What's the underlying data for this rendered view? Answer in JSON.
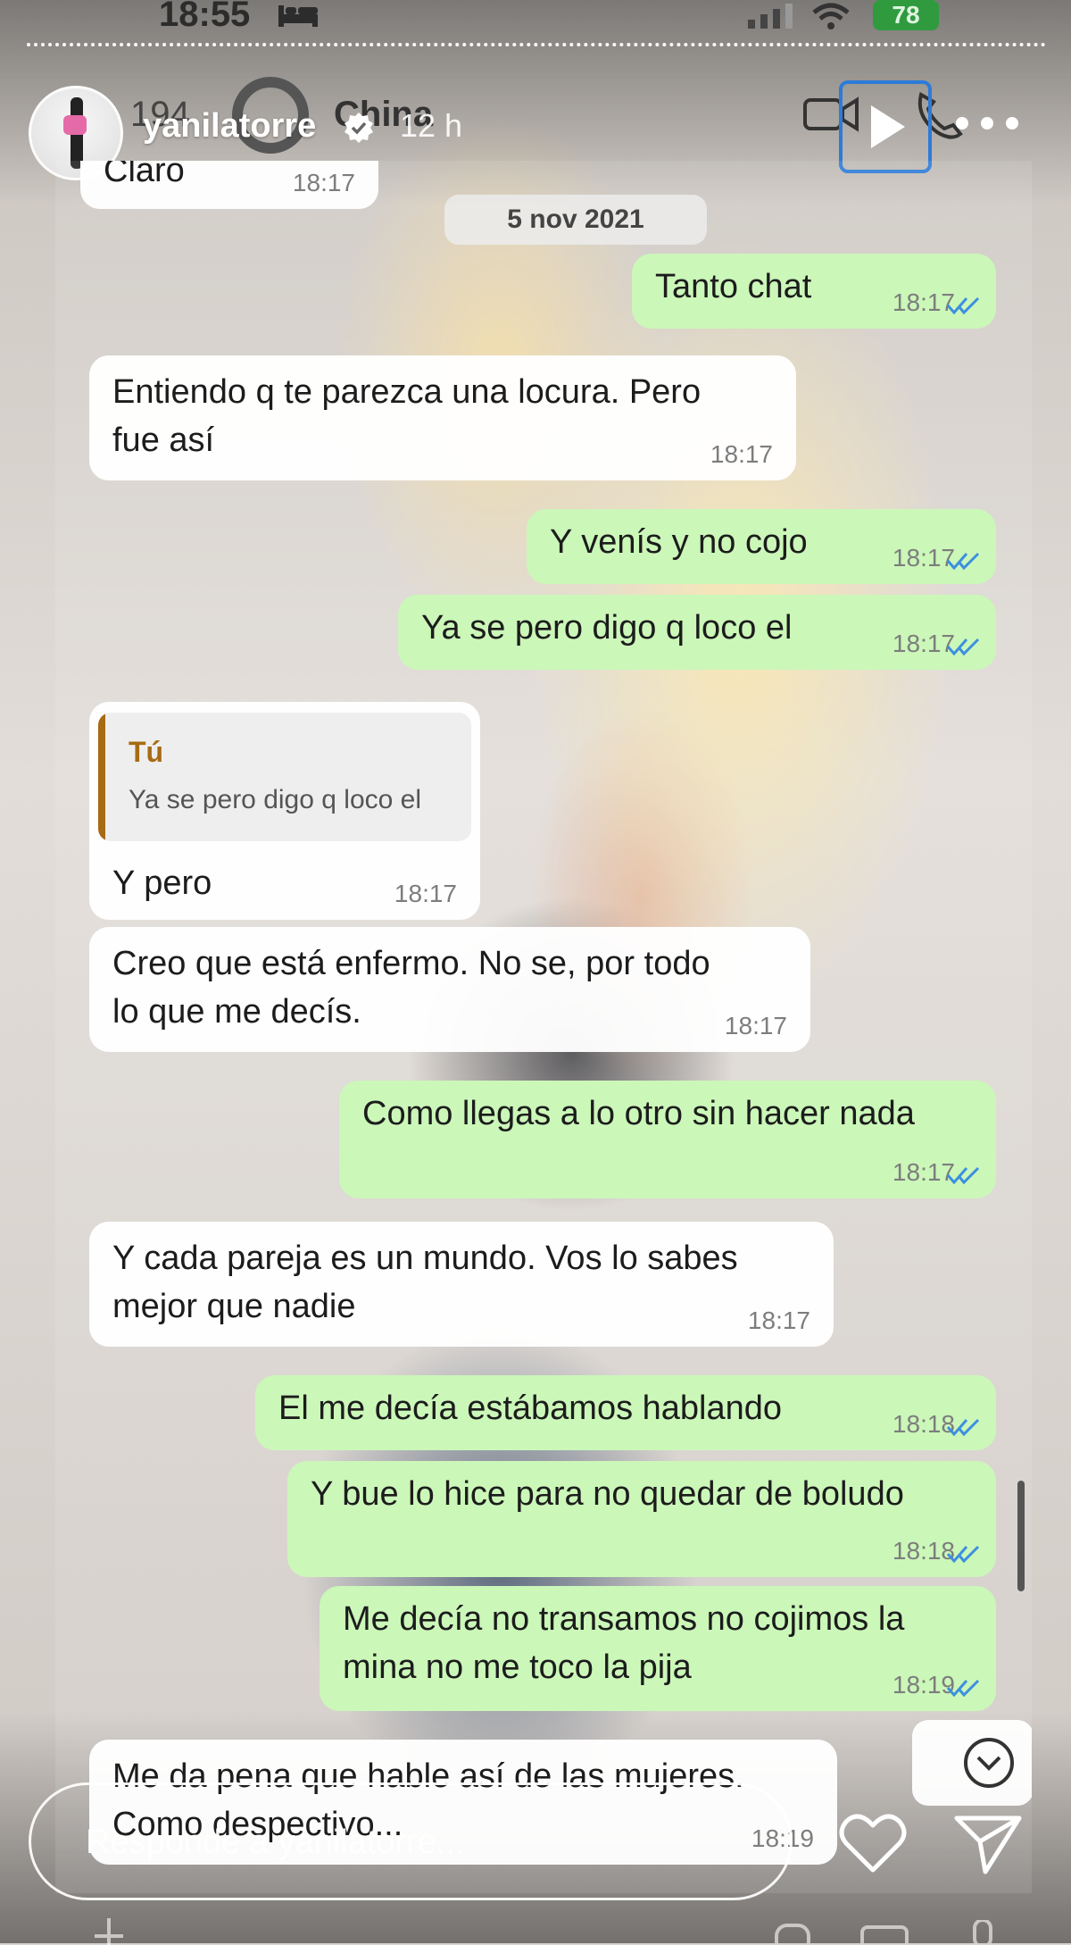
{
  "status_bar": {
    "time": "18:55",
    "battery": "78"
  },
  "story": {
    "username": "yanilatorre",
    "time_ago": "12 h",
    "reply_placeholder": "Responde a yanilatorre..."
  },
  "underlay": {
    "number": "194",
    "name": "China"
  },
  "chat": {
    "date": "5 nov 2021",
    "messages": [
      {
        "type": "in",
        "text": "Claro",
        "time": "18:17"
      },
      {
        "type": "out",
        "text": "Tanto chat",
        "time": "18:17"
      },
      {
        "type": "in",
        "text": "Entiendo q te parezca una locura. Pero\nfue así",
        "time": "18:17"
      },
      {
        "type": "out",
        "text": "Y venís y no cojo",
        "time": "18:17"
      },
      {
        "type": "out",
        "text": "Ya se pero digo q loco el",
        "time": "18:17"
      },
      {
        "type": "in",
        "quote_author": "Tú",
        "quote_text": "Ya se pero digo q loco el",
        "text": "Y pero",
        "time": "18:17"
      },
      {
        "type": "in",
        "text": "Creo que está enfermo. No se, por todo\nlo que me decís.",
        "time": "18:17"
      },
      {
        "type": "out",
        "text": "Como llegas a lo otro sin hacer nada",
        "time": "18:17"
      },
      {
        "type": "in",
        "text": "Y cada pareja es un mundo. Vos lo sabes\nmejor que nadie",
        "time": "18:17"
      },
      {
        "type": "out",
        "text": "El me decía estábamos hablando",
        "time": "18:18"
      },
      {
        "type": "out",
        "text": "Y bue lo hice para no quedar de boludo",
        "time": "18:18"
      },
      {
        "type": "out",
        "text": "Me decía no transamos no cojimos la\nmina no me toco la pija",
        "time": "18:19"
      },
      {
        "type": "in",
        "text": "Me da pena que hable así de las mujeres.\nComo despectivo...",
        "time": "18:19"
      }
    ]
  },
  "colors": {
    "outgoing_bubble": "#cbf7b9",
    "incoming_bubble": "#ffffff",
    "read_check": "#3d8fe0",
    "quote_accent": "#a76b14"
  },
  "icons": [
    "bed-icon",
    "signal-icon",
    "wifi-icon",
    "verified-icon",
    "play-icon",
    "more-icon",
    "check-icon",
    "chevron-down-icon",
    "heart-icon",
    "send-icon"
  ]
}
